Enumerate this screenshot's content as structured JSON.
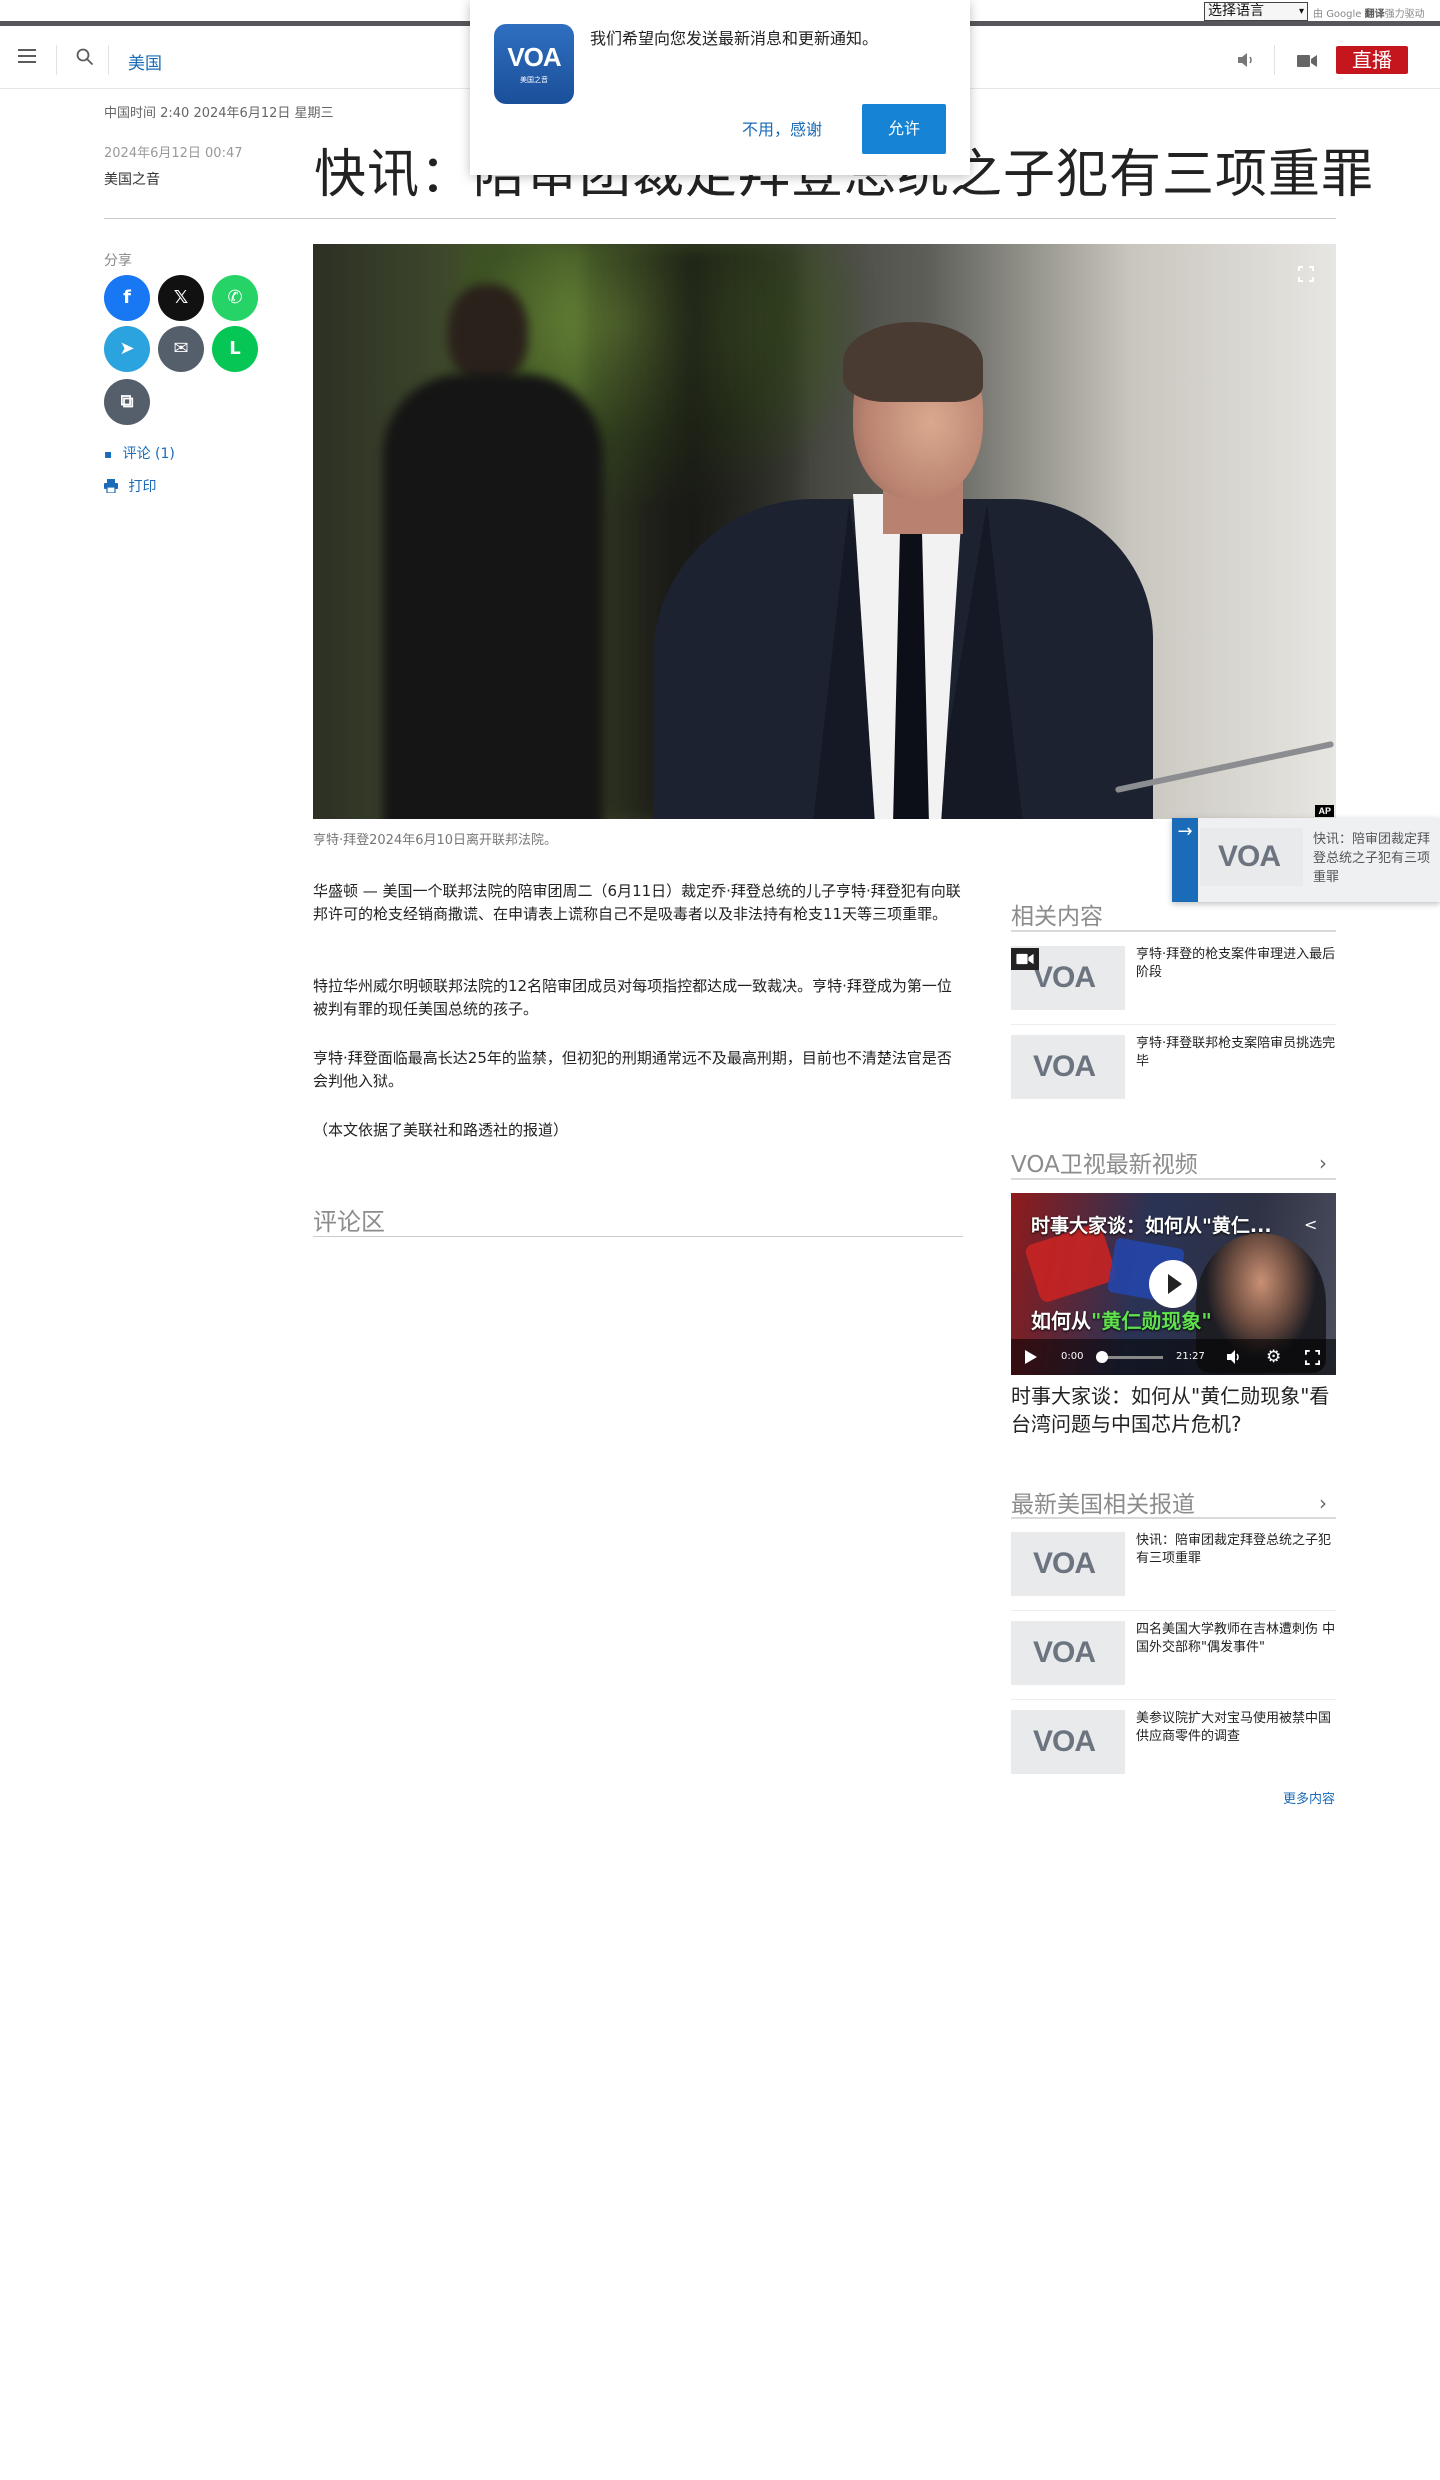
{
  "translate_bar": {
    "select_label": "选择语言",
    "powered_prefix": "由",
    "powered_google": "Google",
    "powered_translate": "翻译",
    "powered_suffix": "强力驱动"
  },
  "header": {
    "section": "美国",
    "live_label": "直播"
  },
  "notification": {
    "logo_text": "VOA",
    "logo_sub": "美国之音",
    "message": "我们希望向您发送最新消息和更新通知。",
    "decline_label": "不用，感谢",
    "allow_label": "允许"
  },
  "article": {
    "dateline": "中国时间 2:40 2024年6月12日 星期三",
    "published": "2024年6月12日 00:47",
    "author": "美国之音",
    "headline": "快讯：陪审团裁定拜登总统之子犯有三项重罪",
    "caption": "亨特·拜登2024年6月10日离开联邦法院。",
    "photo_credit": "AP",
    "paragraphs": [
      "华盛顿 — 美国一个联邦法院的陪审团周二（6月11日）裁定乔·拜登总统的儿子亨特·拜登犯有向联邦许可的枪支经销商撒谎、在申请表上谎称自己不是吸毒者以及非法持有枪支11天等三项重罪。",
      "特拉华州威尔明顿联邦法院的12名陪审团成员对每项指控都达成一致裁决。亨特·拜登成为第一位被判有罪的现任美国总统的孩子。",
      "亨特·拜登面临最高长达25年的监禁，但初犯的刑期通常远不及最高刑期，目前也不清楚法官是否会判他入狱。",
      "（本文依据了美联社和路透社的报道）"
    ],
    "comments_title": "评论区"
  },
  "share": {
    "label": "分享",
    "buttons": [
      {
        "name": "facebook",
        "glyph": "f",
        "color": "#1877f2"
      },
      {
        "name": "x",
        "glyph": "𝕏",
        "color": "#111111"
      },
      {
        "name": "whatsapp",
        "glyph": "✆",
        "color": "#25d366"
      },
      {
        "name": "telegram",
        "glyph": "➤",
        "color": "#2aa3df"
      },
      {
        "name": "email",
        "glyph": "✉",
        "color": "#555e6b"
      },
      {
        "name": "line",
        "glyph": "L",
        "color": "#06c755"
      },
      {
        "name": "copy",
        "glyph": "⧉",
        "color": "#555e6b"
      }
    ],
    "comment_link": "评论 (1)",
    "print_link": "打印"
  },
  "related": {
    "title": "相关内容",
    "items": [
      {
        "title": "亨特·拜登的枪支案件审理进入最后阶段"
      },
      {
        "title": "亨特·拜登联邦枪支案陪审员挑选完毕"
      }
    ]
  },
  "tv": {
    "title": "VOA卫视最新视频",
    "video_overlay_title": "时事大家谈：如何从\"黄仁...",
    "video_big_text_a": "如何从",
    "video_big_text_b": "\"黄仁勋现象\"",
    "time_current": "0:00",
    "time_total": "21:27",
    "caption": "时事大家谈：如何从\"黄仁勋现象\"看台湾问题与中国芯片危机?"
  },
  "latest": {
    "title": "最新美国相关报道",
    "items": [
      {
        "title": "快讯：陪审团裁定拜登总统之子犯有三项重罪"
      },
      {
        "title": "四名美国大学教师在吉林遭刺伤 中国外交部称\"偶发事件\""
      },
      {
        "title": "美参议院扩大对宝马使用被禁中国供应商零件的调查"
      }
    ],
    "more_label": "更多内容"
  },
  "floater": {
    "title": "快讯：陪审团裁定拜登总统之子犯有三项重罪"
  },
  "brand": {
    "voa_mark": "VOA",
    "accent": "#1a6bb8",
    "live_red": "#c4161c"
  }
}
